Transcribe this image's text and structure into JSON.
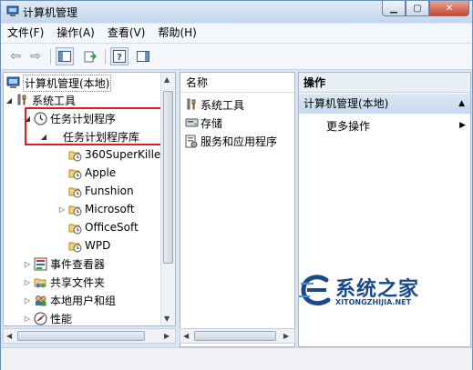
{
  "window": {
    "title": "计算机管理"
  },
  "menu": [
    "文件(F)",
    "操作(A)",
    "查看(V)",
    "帮助(H)"
  ],
  "tree": {
    "root": "计算机管理(本地)",
    "system_tools": "系统工具",
    "task_scheduler": "任务计划程序",
    "task_scheduler_library": "任务计划程序库",
    "library_items": [
      "360SuperKille",
      "Apple",
      "Funshion",
      "Microsoft",
      "OfficeSoft",
      "WPD"
    ],
    "event_viewer": "事件查看器",
    "shared_folders": "共享文件夹",
    "local_users": "本地用户和组",
    "performance": "性能"
  },
  "middle": {
    "header": "名称",
    "items": [
      "系统工具",
      "存储",
      "服务和应用程序"
    ]
  },
  "actions": {
    "header": "操作",
    "section": "计算机管理(本地)",
    "more": "更多操作"
  },
  "watermark": {
    "text": "系统之家",
    "url": "XITONGZHIJIA.NET"
  },
  "colors": {
    "highlight_box": "#e3191c",
    "brand_blue": "#1b4a8a"
  }
}
